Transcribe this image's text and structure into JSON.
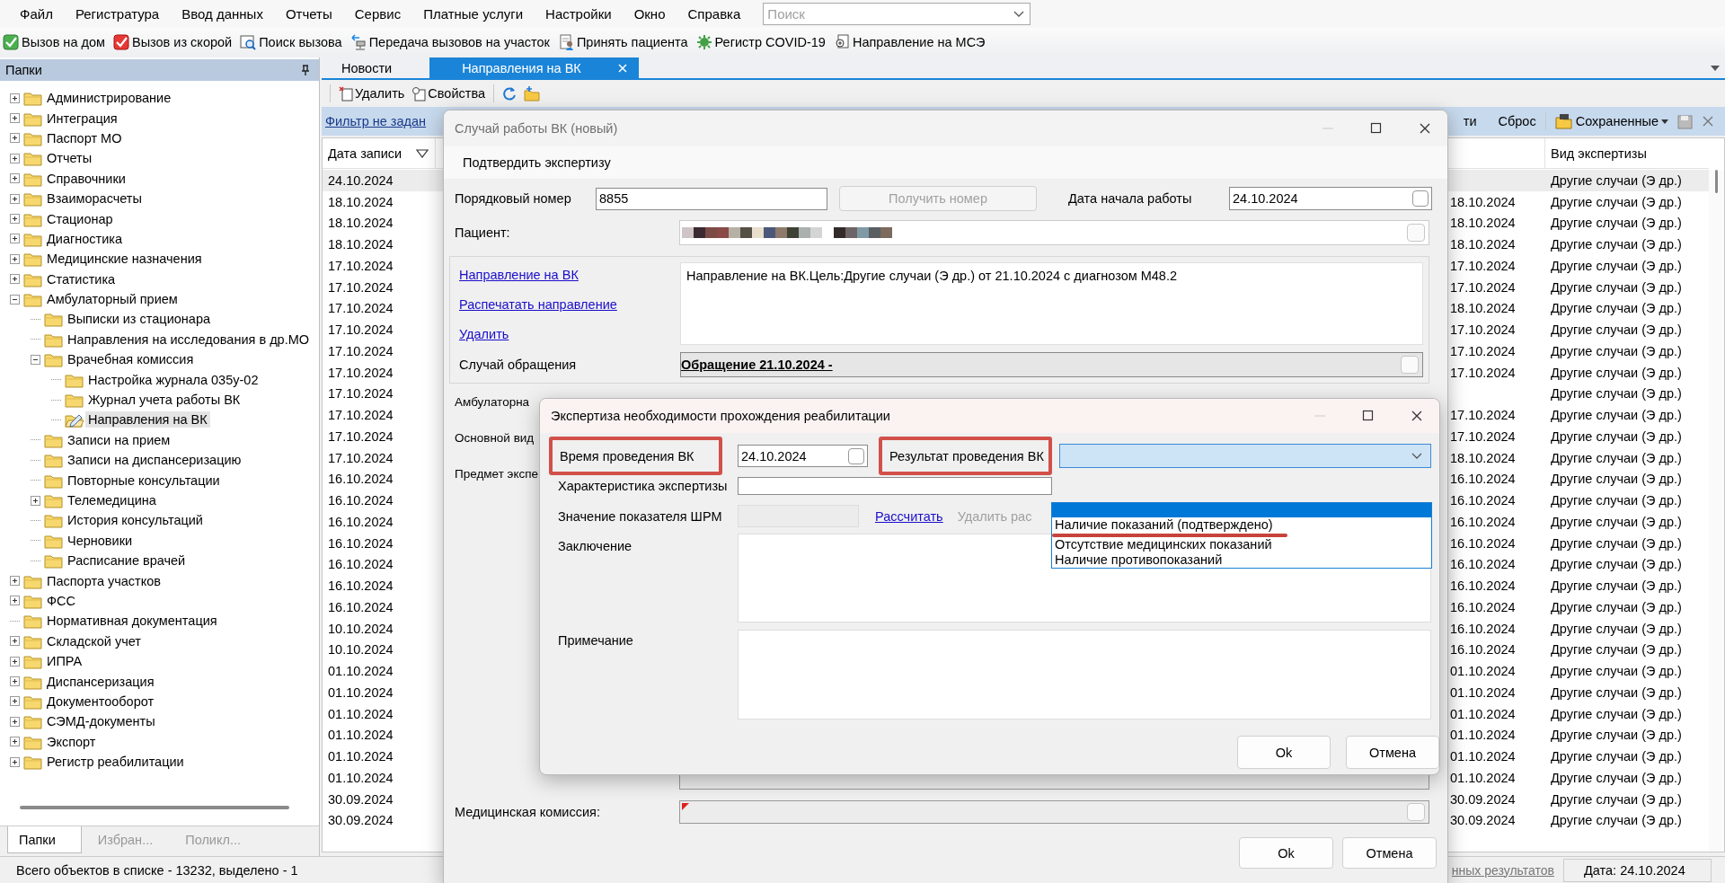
{
  "menu": [
    "Файл",
    "Регистратура",
    "Ввод данных",
    "Отчеты",
    "Сервис",
    "Платные услуги",
    "Настройки",
    "Окно",
    "Справка"
  ],
  "search": {
    "placeholder": "Поиск"
  },
  "toolbar": [
    "Вызов на дом",
    "Вызов из скорой",
    "Поиск вызова",
    "Передача вызовов на участок",
    "Принять пациента",
    "Регистр COVID-19",
    "Направление на МСЭ"
  ],
  "folders_panel": {
    "title": "Папки",
    "tree": [
      {
        "label": "Администрирование",
        "expanded": false,
        "selected": false
      },
      {
        "label": "Интеграция",
        "expanded": false,
        "selected": false
      },
      {
        "label": "Паспорт МО",
        "expanded": false,
        "selected": false
      },
      {
        "label": "Отчеты",
        "expanded": false,
        "selected": false
      },
      {
        "label": "Справочники",
        "expanded": false,
        "selected": false
      },
      {
        "label": "Взаиморасчеты",
        "expanded": false,
        "selected": false
      },
      {
        "label": "Стационар",
        "expanded": false,
        "selected": false
      },
      {
        "label": "Диагностика",
        "expanded": false,
        "selected": false
      },
      {
        "label": "Медицинские назначения",
        "expanded": false,
        "selected": false
      },
      {
        "label": "Статистика",
        "expanded": false,
        "selected": false
      },
      {
        "label": "Амбулаторный прием",
        "expanded": true,
        "selected": false,
        "children": [
          {
            "label": "Выписки из стационара",
            "selected": false
          },
          {
            "label": "Направления на исследования в др.МО",
            "selected": false
          },
          {
            "label": "Врачебная комиссия",
            "expanded": true,
            "selected": false,
            "children": [
              {
                "label": "Настройка журнала 035у-02",
                "selected": false
              },
              {
                "label": "Журнал учета работы ВК",
                "selected": false
              },
              {
                "label": "Направления на ВК",
                "selected": true
              }
            ]
          },
          {
            "label": "Записи на прием",
            "selected": false
          },
          {
            "label": "Записи на диспансеризацию",
            "selected": false
          },
          {
            "label": "Повторные консультации",
            "selected": false
          },
          {
            "label": "Телемедицина",
            "expanded": false,
            "selected": false
          },
          {
            "label": "История консультаций",
            "selected": false
          },
          {
            "label": "Черновики",
            "selected": false
          },
          {
            "label": "Расписание врачей",
            "selected": false
          }
        ]
      },
      {
        "label": "Паспорта участков",
        "expanded": false,
        "selected": false
      },
      {
        "label": "ФСС",
        "expanded": false,
        "selected": false
      },
      {
        "label": "Нормативная документация",
        "selected": false
      },
      {
        "label": "Складской учет",
        "expanded": false,
        "selected": false
      },
      {
        "label": "ИПРА",
        "expanded": false,
        "selected": false
      },
      {
        "label": "Диспансеризация",
        "expanded": false,
        "selected": false
      },
      {
        "label": "Документооборот",
        "expanded": false,
        "selected": false
      },
      {
        "label": "СЭМД-документы",
        "expanded": false,
        "selected": false
      },
      {
        "label": "Экспорт",
        "expanded": false,
        "selected": false
      },
      {
        "label": "Регистр реабилитации",
        "expanded": false,
        "selected": false
      }
    ],
    "tabs": [
      {
        "label": "Папки",
        "selected": true
      },
      {
        "label": "Избран...",
        "selected": false
      },
      {
        "label": "Поликл...",
        "selected": false
      }
    ]
  },
  "document_tabs": [
    {
      "label": "Новости",
      "selected": false,
      "closable": false
    },
    {
      "label": "Направления на ВК",
      "selected": true,
      "closable": true
    }
  ],
  "list_toolbar": [
    "Удалить",
    "Свойства"
  ],
  "filter_bar": {
    "filter_link": "Фильтр не задан",
    "cut_label": "ти",
    "reset": "Сброс",
    "saved": "Сохраненные"
  },
  "grid": {
    "columns": [
      {
        "label": "Дата записи",
        "sorted": true
      },
      {
        "label": "Вид экспертизы",
        "sorted": false
      }
    ],
    "rows": [
      {
        "date": "24.10.2024",
        "type": "Другие случаи (Э др.)",
        "selected": true
      },
      {
        "date": "18.10.2024",
        "column_3": "18.10.2024",
        "type": "Другие случаи (Э др.)",
        "selected": false
      },
      {
        "date": "18.10.2024",
        "column_3": "18.10.2024",
        "type": "Другие случаи (Э др.)",
        "selected": false
      },
      {
        "date": "18.10.2024",
        "column_3": "18.10.2024",
        "type": "Другие случаи (Э др.)",
        "selected": false
      },
      {
        "date": "17.10.2024",
        "column_3": "17.10.2024",
        "type": "Другие случаи (Э др.)",
        "selected": false
      },
      {
        "date": "17.10.2024",
        "column_3": "17.10.2024",
        "type": "Другие случаи (Э др.)",
        "selected": false
      },
      {
        "date": "17.10.2024",
        "column_3": "18.10.2024",
        "type": "Другие случаи (Э др.)",
        "selected": false
      },
      {
        "date": "17.10.2024",
        "column_3": "17.10.2024",
        "type": "Другие случаи (Э др.)",
        "selected": false
      },
      {
        "date": "17.10.2024",
        "column_3": "17.10.2024",
        "type": "Другие случаи (Э др.)",
        "selected": false
      },
      {
        "date": "17.10.2024",
        "column_3": "17.10.2024",
        "type": "Другие случаи (Э др.)",
        "selected": false
      },
      {
        "date": "17.10.2024",
        "type": "Другие случаи (Э др.)",
        "selected": false
      },
      {
        "date": "17.10.2024",
        "column_3": "17.10.2024",
        "type": "Другие случаи (Э др.)",
        "selected": false
      },
      {
        "date": "17.10.2024",
        "column_3": "17.10.2024",
        "type": "Другие случаи (Э др.)",
        "selected": false
      },
      {
        "date": "17.10.2024",
        "column_3": "18.10.2024",
        "type": "Другие случаи (Э др.)",
        "selected": false
      },
      {
        "date": "16.10.2024",
        "column_3": "16.10.2024",
        "type": "Другие случаи (Э др.)",
        "selected": false
      },
      {
        "date": "16.10.2024",
        "column_3": "16.10.2024",
        "type": "Другие случаи (Э др.)",
        "selected": false
      },
      {
        "date": "16.10.2024",
        "column_3": "16.10.2024",
        "type": "Другие случаи (Э др.)",
        "selected": false
      },
      {
        "date": "16.10.2024",
        "column_3": "16.10.2024",
        "type": "Другие случаи (Э др.)",
        "selected": false
      },
      {
        "date": "16.10.2024",
        "column_3": "16.10.2024",
        "type": "Другие случаи (Э др.)",
        "selected": false
      },
      {
        "date": "16.10.2024",
        "column_3": "16.10.2024",
        "type": "Другие случаи (Э др.)",
        "selected": false
      },
      {
        "date": "16.10.2024",
        "column_3": "16.10.2024",
        "type": "Другие случаи (Э др.)",
        "selected": false
      },
      {
        "date": "10.10.2024",
        "column_3": "16.10.2024",
        "type": "Другие случаи (Э др.)",
        "selected": false
      },
      {
        "date": "10.10.2024",
        "column_3": "16.10.2024",
        "type": "Другие случаи (Э др.)",
        "selected": false
      },
      {
        "date": "01.10.2024",
        "column_3": "01.10.2024",
        "type": "Другие случаи (Э др.)",
        "selected": false
      },
      {
        "date": "01.10.2024",
        "column_3": "01.10.2024",
        "type": "Другие случаи (Э др.)",
        "selected": false
      },
      {
        "date": "01.10.2024",
        "column_3": "01.10.2024",
        "type": "Другие случаи (Э др.)",
        "selected": false
      },
      {
        "date": "01.10.2024",
        "column_3": "01.10.2024",
        "type": "Другие случаи (Э др.)",
        "selected": false
      },
      {
        "date": "01.10.2024",
        "column_3": "01.10.2024",
        "type": "Другие случаи (Э др.)",
        "selected": false
      },
      {
        "date": "01.10.2024",
        "column_3": "01.10.2024",
        "type": "Другие случаи (Э др.)",
        "selected": false
      },
      {
        "date": "30.09.2024",
        "column_3": "30.09.2024",
        "type": "Другие случаи (Э др.)",
        "selected": false
      },
      {
        "date": "30.09.2024",
        "column_3": "30.09.2024",
        "type": "Другие случаи (Э др.)",
        "selected": false
      }
    ]
  },
  "status_bar": {
    "summary": "Всего объектов в списке - 13232, выделено - 1",
    "link": "нных результатов",
    "date": "Дата: 24.10.2024"
  },
  "case_dialog": {
    "title": "Случай работы ВК (новый)",
    "menu_item": "Подтвердить экспертизу",
    "number": {
      "label": "Порядковый номер",
      "value": "8855"
    },
    "get_number_button": {
      "label": "Получить номер",
      "disabled": true
    },
    "start_date": {
      "label": "Дата начала работы",
      "value": "24.10.2024"
    },
    "patient": {
      "label": "Пациент:"
    },
    "links": [
      "Направление на ВК",
      "Распечатать направление",
      "Удалить"
    ],
    "referral_text": "Направление на ВК.Цель:Другие случаи (Э др.) от 21.10.2024 с диагнозом М48.2",
    "visit_case": {
      "label": "Случай обращения",
      "value": "Обращение 21.10.2024 -"
    },
    "hidden_labels": [
      "Амбулаторна",
      "Основной вид",
      "Предмет экспе"
    ],
    "commission": {
      "label": "Медицинская комиссия:",
      "required": true
    },
    "buttons": [
      "Ok",
      "Отмена"
    ]
  },
  "expertise_dialog": {
    "title": "Экспертиза необходимости прохождения реабилитации",
    "time": {
      "label": "Время проведения ВК",
      "highlighted": true,
      "value": "24.10.2024"
    },
    "result": {
      "label": "Результат проведения ВК",
      "highlighted": true,
      "open": true,
      "options": [
        {
          "selected": true,
          "underlined": false
        },
        {
          "label": "Наличие показаний (подтверждено)",
          "selected": false,
          "underlined": true
        },
        {
          "label": "Отсутствие медицинских показаний",
          "selected": false,
          "underlined": false
        },
        {
          "label": "Наличие противопоказаний",
          "selected": false,
          "underlined": false
        }
      ]
    },
    "characteristic": {
      "label": "Характеристика экспертизы"
    },
    "srm": {
      "label": "Значение показателя ШРМ",
      "disabled": true,
      "calculate_link": "Рассчитать",
      "delete_link": {
        "label": "Удалить рас",
        "disabled": true
      }
    },
    "conclusion": {
      "label": "Заключение"
    },
    "note": {
      "label": "Примечание"
    },
    "buttons": [
      "Ok",
      "Отмена"
    ]
  }
}
